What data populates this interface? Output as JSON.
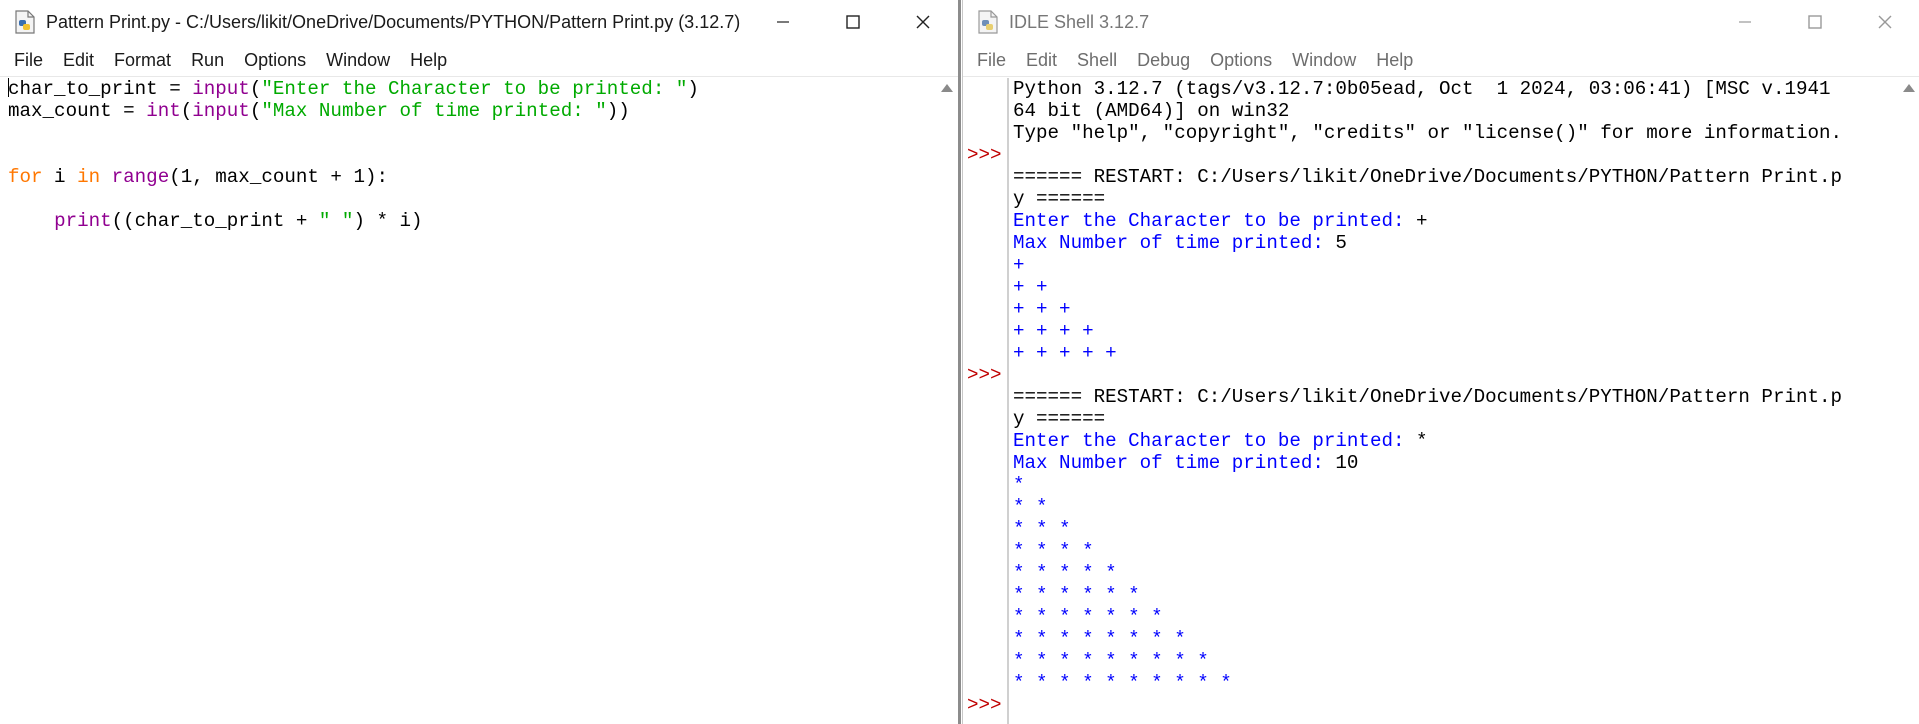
{
  "editor": {
    "title": "Pattern Print.py - C:/Users/likit/OneDrive/Documents/PYTHON/Pattern Print.py (3.12.7)",
    "menu": [
      "File",
      "Edit",
      "Format",
      "Run",
      "Options",
      "Window",
      "Help"
    ],
    "code": {
      "l1_var": "char_to_print = ",
      "l1_func": "input",
      "l1_open": "(",
      "l1_str": "\"Enter the Character to be printed: \"",
      "l1_close": ")",
      "l2_var": "max_count = ",
      "l2_func1": "int",
      "l2_open1": "(",
      "l2_func2": "input",
      "l2_open2": "(",
      "l2_str": "\"Max Number of time printed: \"",
      "l2_close": "))",
      "l5_kw1": "for",
      "l5_a": " i ",
      "l5_kw2": "in",
      "l5_sp": " ",
      "l5_func": "range",
      "l5_rest": "(1, max_count + 1):",
      "l7_indent": "    ",
      "l7_func": "print",
      "l7_a": "((char_to_print + ",
      "l7_str": "\" \"",
      "l7_b": ") * i)"
    }
  },
  "shell": {
    "title": "IDLE Shell 3.12.7",
    "menu": [
      "File",
      "Edit",
      "Shell",
      "Debug",
      "Options",
      "Window",
      "Help"
    ],
    "prompt": ">>>",
    "lines": {
      "banner1": "Python 3.12.7 (tags/v3.12.7:0b05ead, Oct  1 2024, 03:06:41) [MSC v.1941",
      "banner2": "64 bit (AMD64)] on win32",
      "banner3": "Type \"help\", \"copyright\", \"credits\" or \"license()\" for more information.",
      "restart1a": "====== RESTART: C:/Users/likit/OneDrive/Documents/PYTHON/Pattern Print.p",
      "restart1b": "y ======",
      "run1_q1": "Enter the Character to be printed: ",
      "run1_a1": "+",
      "run1_q2": "Max Number of time printed: ",
      "run1_a2": "5",
      "run1_out": [
        "+",
        "+ +",
        "+ + +",
        "+ + + +",
        "+ + + + +"
      ],
      "restart2a": "====== RESTART: C:/Users/likit/OneDrive/Documents/PYTHON/Pattern Print.p",
      "restart2b": "y ======",
      "run2_q1": "Enter the Character to be printed: ",
      "run2_a1": "*",
      "run2_q2": "Max Number of time printed: ",
      "run2_a2": "10",
      "run2_out": [
        "*",
        "* *",
        "* * *",
        "* * * *",
        "* * * * *",
        "* * * * * *",
        "* * * * * * *",
        "* * * * * * * *",
        "* * * * * * * * *",
        "* * * * * * * * * *"
      ]
    }
  }
}
